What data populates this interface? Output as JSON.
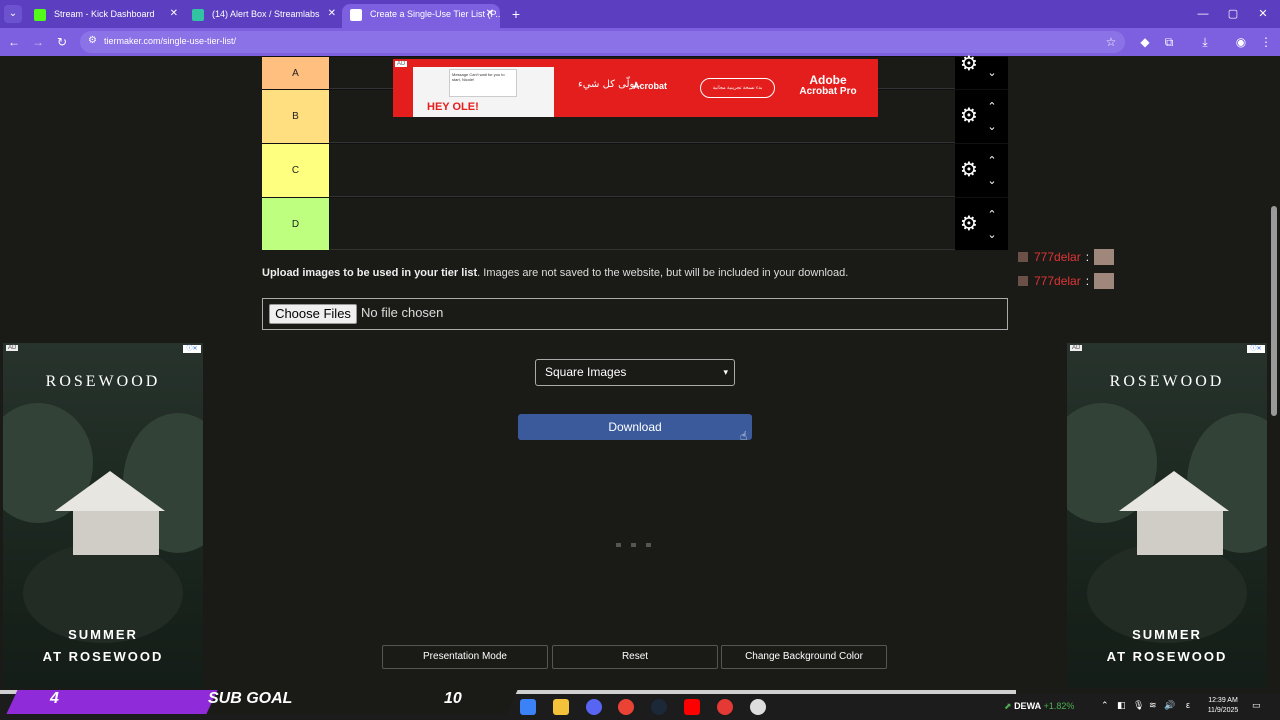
{
  "browser": {
    "tabs": [
      {
        "title": "Stream - Kick Dashboard",
        "active": false,
        "favicon_color": "#53fc18"
      },
      {
        "title": "(14) Alert Box / Streamlabs",
        "active": false,
        "favicon_color": "#31c3a2"
      },
      {
        "title": "Create a Single-Use Tier List (P...",
        "active": true,
        "favicon_color": "#ffffff"
      }
    ],
    "url": "tiermaker.com/single-use-tier-list/"
  },
  "tiers": [
    {
      "label": "A",
      "color": "#ffbf7f"
    },
    {
      "label": "B",
      "color": "#ffdf7f"
    },
    {
      "label": "C",
      "color": "#ffff7f"
    },
    {
      "label": "D",
      "color": "#bfff7f"
    }
  ],
  "top_ad": {
    "tag": "AD",
    "hey": "HEY   OLE!",
    "message": "Message\nCan't wait for you to start, Nicole!",
    "arabic": "تولّى كل شيء.",
    "product": "Acrobat",
    "trial": "بدء نسخة تجريبية مجانية",
    "brand_line1": "Adobe",
    "brand_line2": "Acrobat Pro"
  },
  "chat": [
    {
      "user": "777delar"
    },
    {
      "user": "777delar"
    }
  ],
  "upload": {
    "bold": "Upload images to be used in your tier list",
    "rest": ". Images are not saved to the website, but will be included in your download.",
    "button": "Choose Files",
    "status": "No file chosen"
  },
  "image_mode": {
    "selected": "Square Images"
  },
  "download_label": "Download",
  "bottom_buttons": [
    "Presentation Mode",
    "Reset",
    "Change Background Color"
  ],
  "side_ad": {
    "tag": "AD",
    "brand": "ROSEWOOD",
    "line1": "SUMMER",
    "line2": "AT ROSEWOOD"
  },
  "overlay": {
    "current": "4",
    "label": "SUB GOAL",
    "target": "10",
    "progress_fraction": 0.4
  },
  "taskbar": {
    "stock_name": "DEWA",
    "stock_change": "+1.82%",
    "time": "12:39 AM",
    "date": "11/9/2025"
  }
}
